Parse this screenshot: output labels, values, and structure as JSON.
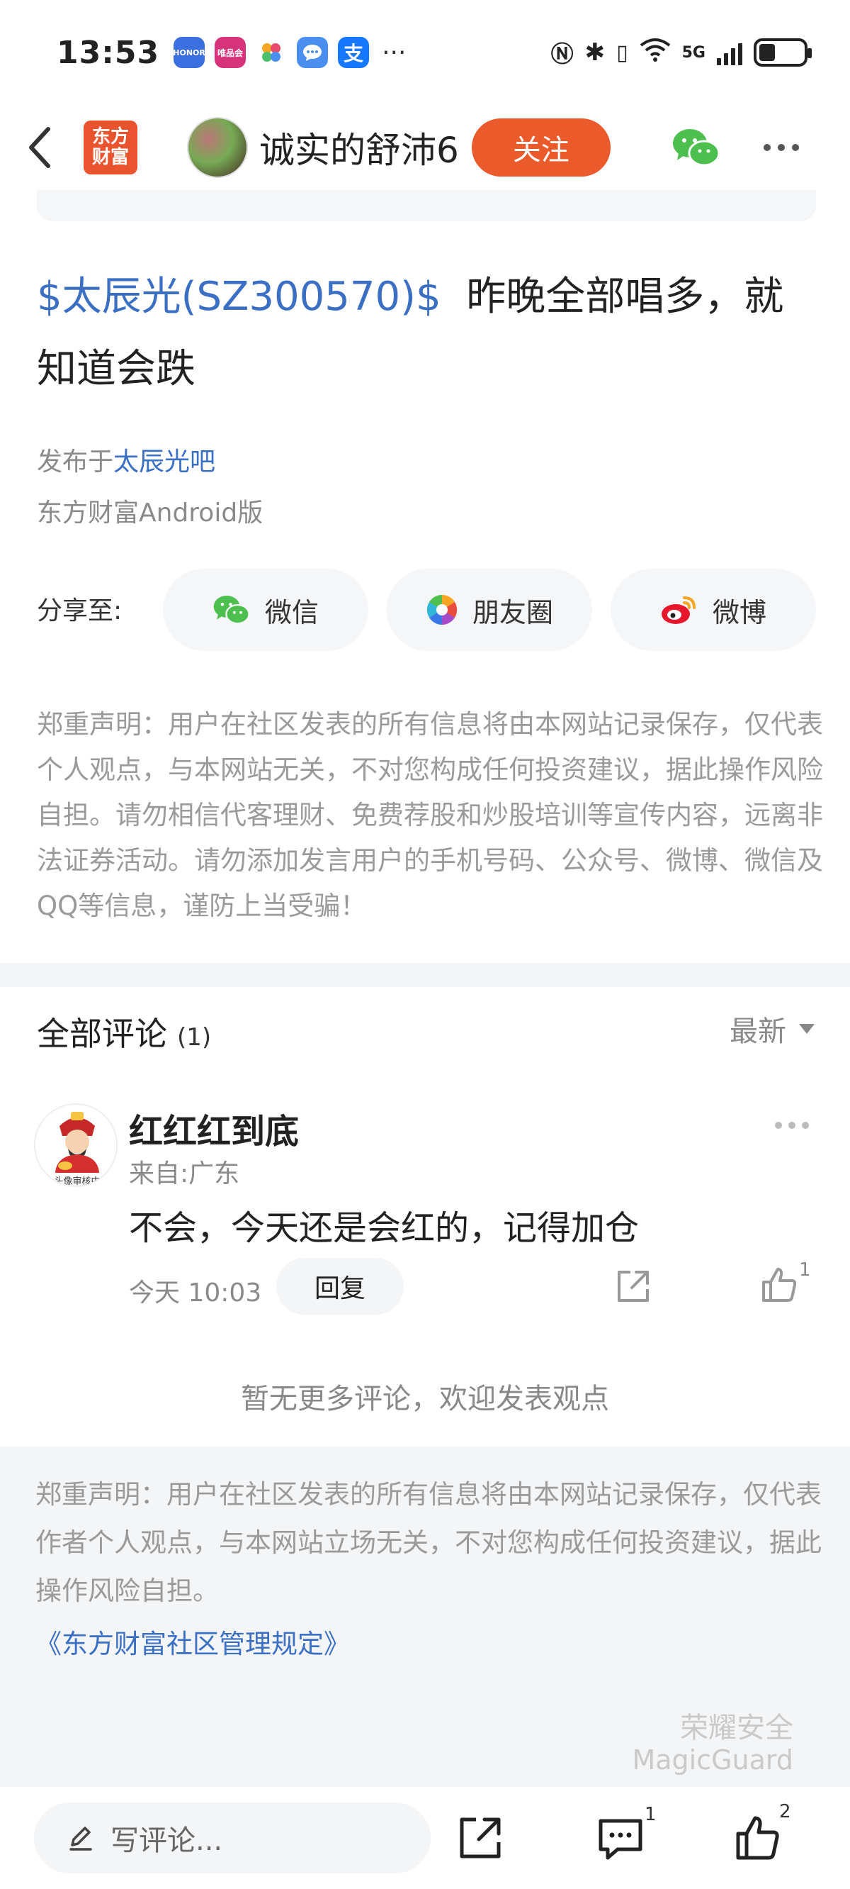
{
  "status_bar": {
    "time": "13:53",
    "app_icons": [
      "honor-icon",
      "vipshop-icon",
      "photos-icon",
      "messages-icon",
      "alipay-icon"
    ],
    "app_labels": [
      "HONOR",
      "唯品会"
    ],
    "more": "···",
    "network": "5G"
  },
  "header": {
    "logo_text": "东方财富",
    "logo_line1": "东方",
    "logo_line2": "财富",
    "username": "诚实的舒沛6",
    "follow_label": "关注"
  },
  "post": {
    "stock_tag": "$太辰光(SZ300570)$",
    "title_text": "昨晚全部唱多，就知道会跌",
    "published_prefix": "发布于",
    "forum": "太辰光吧",
    "client": "东方财富Android版"
  },
  "share": {
    "label": "分享至:",
    "wechat": "微信",
    "moments": "朋友圈",
    "weibo": "微博"
  },
  "disclaimer_top": "郑重声明：用户在社区发表的所有信息将由本网站记录保存，仅代表个人观点，与本网站无关，不对您构成任何投资建议，据此操作风险自担。请勿相信代客理财、免费荐股和炒股培训等宣传内容，远离非法证券活动。请勿添加发言用户的手机号码、公众号、微博、微信及QQ等信息，谨防上当受骗！",
  "comments": {
    "title": "全部评论",
    "count": "(1)",
    "sort_label": "最新",
    "items": [
      {
        "avatar_caption": "头像审核中",
        "name": "红红红到底",
        "from": "来自:广东",
        "text": "不会，今天还是会红的，记得加仓",
        "time": "今天 10:03",
        "reply_label": "回复",
        "like_count": "1"
      }
    ],
    "no_more": "暂无更多评论，欢迎发表观点"
  },
  "disclaimer_bottom": "郑重声明：用户在社区发表的所有信息将由本网站记录保存，仅代表作者个人观点，与本网站立场无关，不对您构成任何投资建议，据此操作风险自担。",
  "rules_link": "《东方财富社区管理规定》",
  "watermark": {
    "line1": "荣耀安全",
    "line2": "MagicGuard"
  },
  "bottom_bar": {
    "comment_placeholder": "写评论...",
    "comment_count": "1",
    "like_count": "2"
  },
  "colors": {
    "accent_orange": "#eb5a2a",
    "link_blue": "#3a6fc4",
    "muted_gray": "#8a8a8a"
  }
}
